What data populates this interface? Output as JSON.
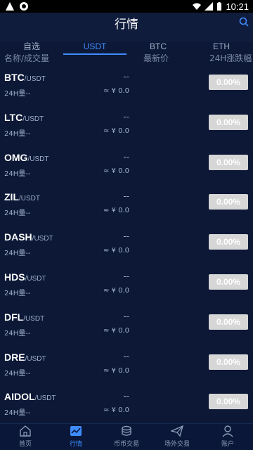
{
  "statusbar": {
    "time": "10:21"
  },
  "header": {
    "title": "行情"
  },
  "tabs": [
    {
      "label": "自选",
      "active": false
    },
    {
      "label": "USDT",
      "active": true
    },
    {
      "label": "BTC",
      "active": false
    },
    {
      "label": "ETH",
      "active": false
    }
  ],
  "columns": {
    "name_volume": "名称/成交量",
    "last_price": "最新价",
    "change_24h": "24H涨跌幅"
  },
  "rows": [
    {
      "base": "BTC",
      "quote": "/USDT",
      "volume": "24H量--",
      "price": "--",
      "approx": "≈ ¥ 0.0",
      "change": "0.00%"
    },
    {
      "base": "LTC",
      "quote": "/USDT",
      "volume": "24H量--",
      "price": "--",
      "approx": "≈ ¥ 0.0",
      "change": "0.00%"
    },
    {
      "base": "OMG",
      "quote": "/USDT",
      "volume": "24H量--",
      "price": "--",
      "approx": "≈ ¥ 0.0",
      "change": "0.00%"
    },
    {
      "base": "ZIL",
      "quote": "/USDT",
      "volume": "24H量--",
      "price": "--",
      "approx": "≈ ¥ 0.0",
      "change": "0.00%"
    },
    {
      "base": "DASH",
      "quote": "/USDT",
      "volume": "24H量--",
      "price": "--",
      "approx": "≈ ¥ 0.0",
      "change": "0.00%"
    },
    {
      "base": "HDS",
      "quote": "/USDT",
      "volume": "24H量--",
      "price": "--",
      "approx": "≈ ¥ 0.0",
      "change": "0.00%"
    },
    {
      "base": "DFL",
      "quote": "/USDT",
      "volume": "24H量--",
      "price": "--",
      "approx": "≈ ¥ 0.0",
      "change": "0.00%"
    },
    {
      "base": "DRE",
      "quote": "/USDT",
      "volume": "24H量--",
      "price": "--",
      "approx": "≈ ¥ 0.0",
      "change": "0.00%"
    },
    {
      "base": "AIDOL",
      "quote": "/USDT",
      "volume": "24H量--",
      "price": "--",
      "approx": "≈ ¥ 0.0",
      "change": "0.00%"
    }
  ],
  "bottomnav": [
    {
      "label": "首页",
      "icon": "home-icon",
      "active": false
    },
    {
      "label": "行情",
      "icon": "chart-icon",
      "active": true
    },
    {
      "label": "币币交易",
      "icon": "coins-icon",
      "active": false
    },
    {
      "label": "场外交易",
      "icon": "paper-plane-icon",
      "active": false
    },
    {
      "label": "账户",
      "icon": "user-icon",
      "active": false
    }
  ],
  "colors": {
    "accent": "#3f8cff",
    "background": "#0c1836",
    "change_badge": "#d6d6d6"
  }
}
